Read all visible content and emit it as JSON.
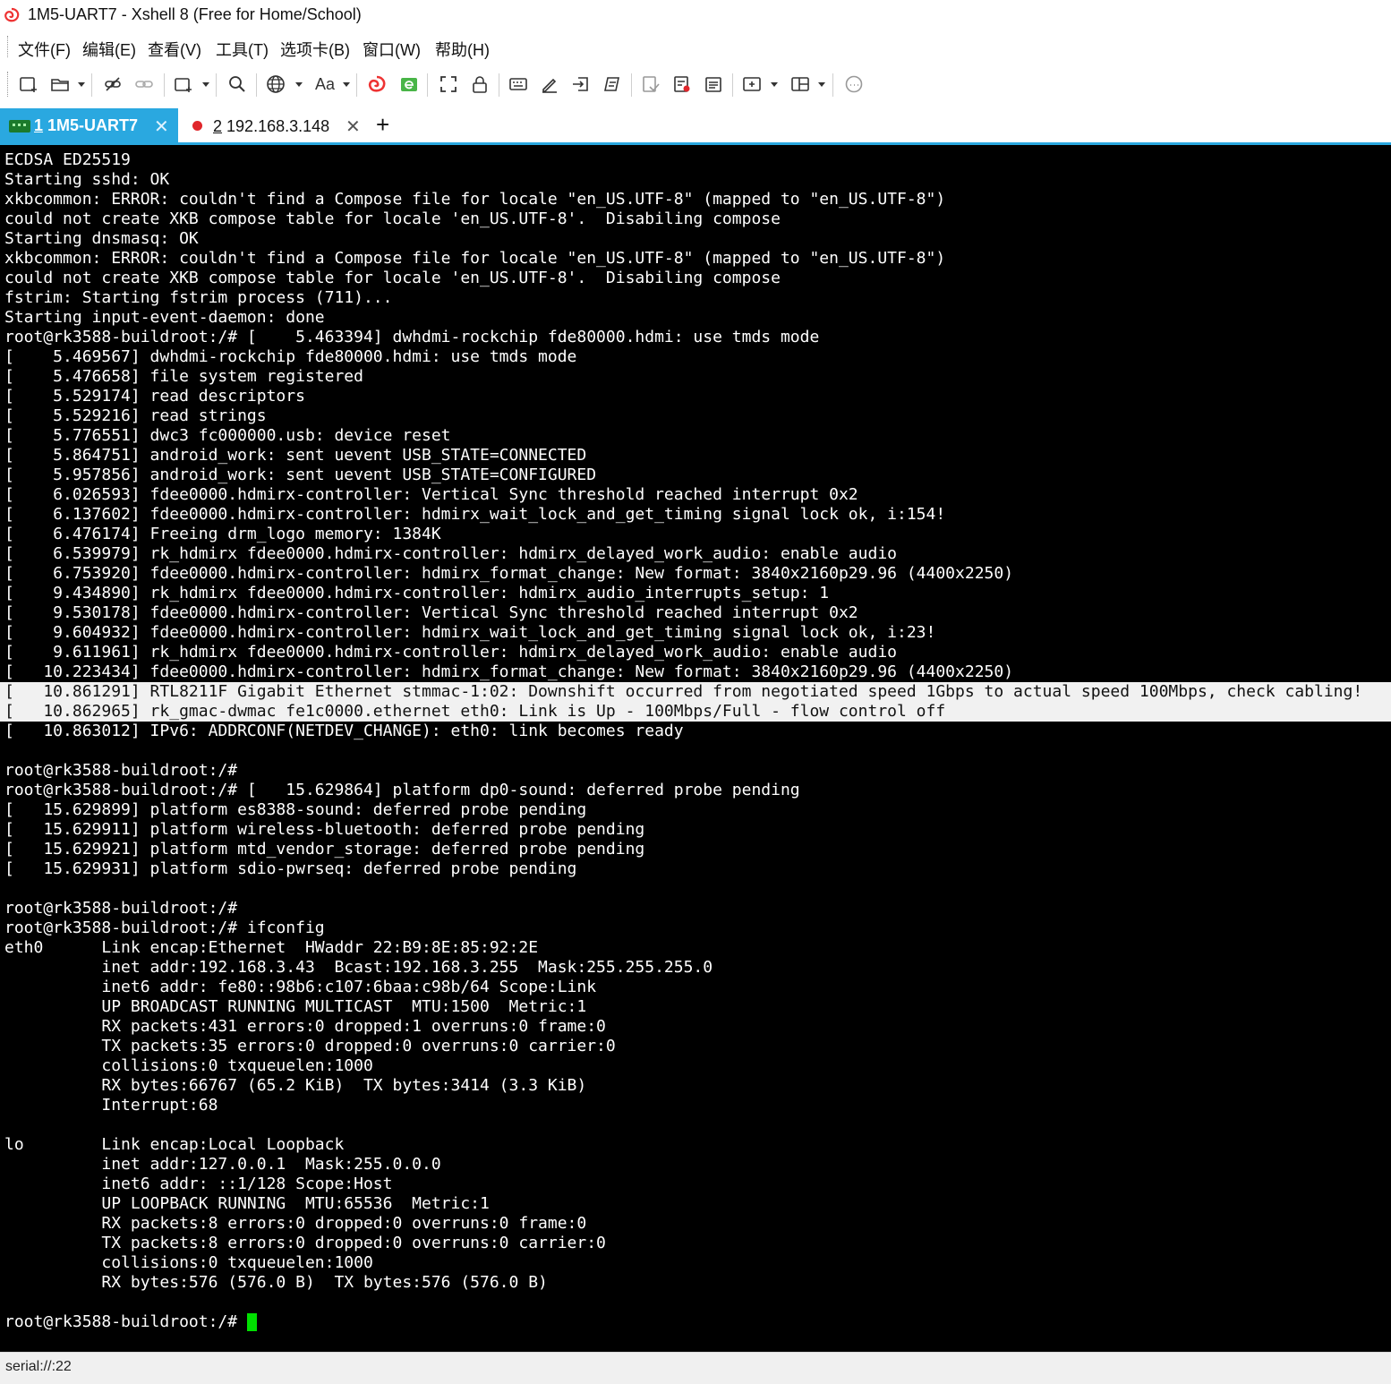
{
  "window": {
    "title": "1M5-UART7 - Xshell 8 (Free for Home/School)"
  },
  "menu": [
    "文件(F)",
    "编辑(E)",
    "查看(V)",
    "工具(T)",
    "选项卡(B)",
    "窗口(W)",
    "帮助(H)"
  ],
  "toolbar": {
    "font_button_label": "Aa",
    "icons": [
      "new-session-icon",
      "open-folder-icon",
      "disconnect-icon",
      "reconnect-icon",
      "new-tab-icon",
      "find-icon",
      "globe-icon",
      "font-icon",
      "xshell-icon",
      "xftp-icon",
      "fullscreen-icon",
      "lock-icon",
      "keyboard-icon",
      "compose-icon",
      "transfer-icon",
      "script-icon",
      "log-icon",
      "record-icon",
      "notes-icon",
      "add-pane-icon",
      "layout-icon",
      "chat-icon"
    ]
  },
  "tabs": [
    {
      "num": "1",
      "label": "1M5-UART7",
      "active": true,
      "close": "✕"
    },
    {
      "num": "2",
      "label": "192.168.3.148",
      "active": false,
      "close": "✕"
    }
  ],
  "tab_add": "+",
  "terminal": {
    "lines": [
      "ECDSA ED25519",
      "Starting sshd: OK",
      "xkbcommon: ERROR: couldn't find a Compose file for locale \"en_US.UTF-8\" (mapped to \"en_US.UTF-8\")",
      "could not create XKB compose table for locale 'en_US.UTF-8'.  Disabiling compose",
      "Starting dnsmasq: OK",
      "xkbcommon: ERROR: couldn't find a Compose file for locale \"en_US.UTF-8\" (mapped to \"en_US.UTF-8\")",
      "could not create XKB compose table for locale 'en_US.UTF-8'.  Disabiling compose",
      "fstrim: Starting fstrim process (711)...",
      "Starting input-event-daemon: done",
      "root@rk3588-buildroot:/# [    5.463394] dwhdmi-rockchip fde80000.hdmi: use tmds mode",
      "[    5.469567] dwhdmi-rockchip fde80000.hdmi: use tmds mode",
      "[    5.476658] file system registered",
      "[    5.529174] read descriptors",
      "[    5.529216] read strings",
      "[    5.776551] dwc3 fc000000.usb: device reset",
      "[    5.864751] android_work: sent uevent USB_STATE=CONNECTED",
      "[    5.957856] android_work: sent uevent USB_STATE=CONFIGURED",
      "[    6.026593] fdee0000.hdmirx-controller: Vertical Sync threshold reached interrupt 0x2",
      "[    6.137602] fdee0000.hdmirx-controller: hdmirx_wait_lock_and_get_timing signal lock ok, i:154!",
      "[    6.476174] Freeing drm_logo memory: 1384K",
      "[    6.539979] rk_hdmirx fdee0000.hdmirx-controller: hdmirx_delayed_work_audio: enable audio",
      "[    6.753920] fdee0000.hdmirx-controller: hdmirx_format_change: New format: 3840x2160p29.96 (4400x2250)",
      "[    9.434890] rk_hdmirx fdee0000.hdmirx-controller: hdmirx_audio_interrupts_setup: 1",
      "[    9.530178] fdee0000.hdmirx-controller: Vertical Sync threshold reached interrupt 0x2",
      "[    9.604932] fdee0000.hdmirx-controller: hdmirx_wait_lock_and_get_timing signal lock ok, i:23!",
      "[    9.611961] rk_hdmirx fdee0000.hdmirx-controller: hdmirx_delayed_work_audio: enable audio",
      "[   10.223434] fdee0000.hdmirx-controller: hdmirx_format_change: New format: 3840x2160p29.96 (4400x2250)",
      "[   10.861291] RTL8211F Gigabit Ethernet stmmac-1:02: Downshift occurred from negotiated speed 1Gbps to actual speed 100Mbps, check cabling!",
      "[   10.862965] rk_gmac-dwmac fe1c0000.ethernet eth0: Link is Up - 100Mbps/Full - flow control off",
      "[   10.863012] IPv6: ADDRCONF(NETDEV_CHANGE): eth0: link becomes ready",
      "",
      "root@rk3588-buildroot:/#",
      "root@rk3588-buildroot:/# [   15.629864] platform dp0-sound: deferred probe pending",
      "[   15.629899] platform es8388-sound: deferred probe pending",
      "[   15.629911] platform wireless-bluetooth: deferred probe pending",
      "[   15.629921] platform mtd_vendor_storage: deferred probe pending",
      "[   15.629931] platform sdio-pwrseq: deferred probe pending",
      "",
      "root@rk3588-buildroot:/#",
      "root@rk3588-buildroot:/# ifconfig",
      "eth0      Link encap:Ethernet  HWaddr 22:B9:8E:85:92:2E",
      "          inet addr:192.168.3.43  Bcast:192.168.3.255  Mask:255.255.255.0",
      "          inet6 addr: fe80::98b6:c107:6baa:c98b/64 Scope:Link",
      "          UP BROADCAST RUNNING MULTICAST  MTU:1500  Metric:1",
      "          RX packets:431 errors:0 dropped:1 overruns:0 frame:0",
      "          TX packets:35 errors:0 dropped:0 overruns:0 carrier:0",
      "          collisions:0 txqueuelen:1000",
      "          RX bytes:66767 (65.2 KiB)  TX bytes:3414 (3.3 KiB)",
      "          Interrupt:68",
      "",
      "lo        Link encap:Local Loopback",
      "          inet addr:127.0.0.1  Mask:255.0.0.0",
      "          inet6 addr: ::1/128 Scope:Host",
      "          UP LOOPBACK RUNNING  MTU:65536  Metric:1",
      "          RX packets:8 errors:0 dropped:0 overruns:0 frame:0",
      "          TX packets:8 errors:0 dropped:0 overruns:0 carrier:0",
      "          collisions:0 txqueuelen:1000",
      "          RX bytes:576 (576.0 B)  TX bytes:576 (576.0 B)",
      "",
      "root@rk3588-buildroot:/# "
    ],
    "selected_lines": [
      27,
      28
    ],
    "cursor_color": "#00e000"
  },
  "status": {
    "text": "serial://:22"
  },
  "colors": {
    "accent": "#2aa8e0",
    "terminal_bg": "#000000",
    "terminal_fg": "#ffffff",
    "tab2_dot": "#e0262b"
  }
}
